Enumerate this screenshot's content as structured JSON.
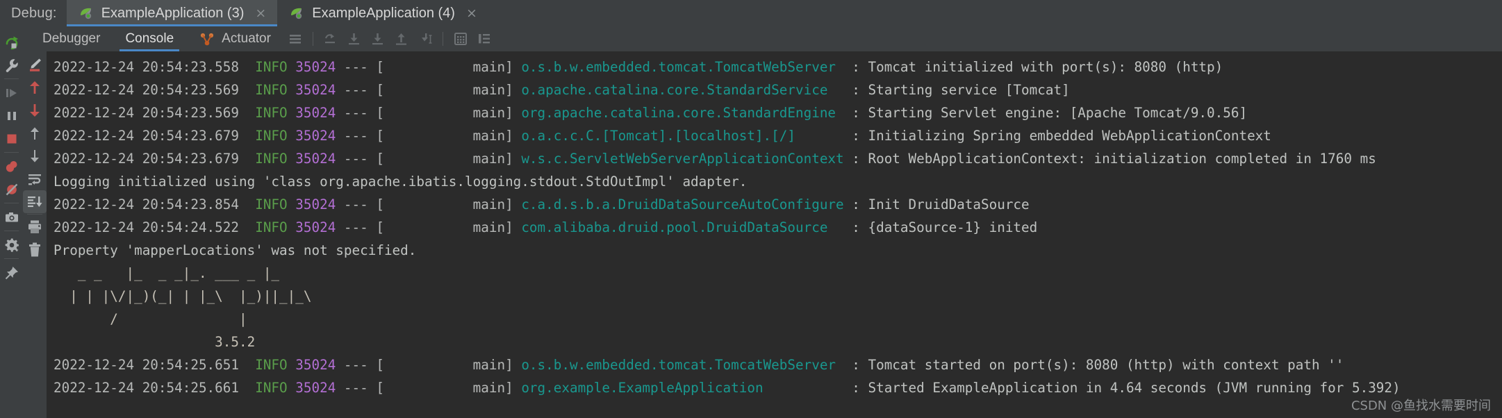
{
  "window": {
    "debug_label": "Debug:",
    "tabs": [
      {
        "title": "ExampleApplication (3)",
        "close": "×",
        "active": true,
        "icon": "spring-boot-icon"
      },
      {
        "title": "ExampleApplication (4)",
        "close": "×",
        "active": false,
        "icon": "spring-boot-icon"
      }
    ]
  },
  "left_rail": {
    "items": [
      {
        "name": "rerun-icon",
        "label": "Rerun"
      },
      {
        "name": "wrench-icon",
        "label": "Edit Configuration"
      },
      {
        "name": "resume-program-icon",
        "label": "Resume Program"
      },
      {
        "name": "pause-program-icon",
        "label": "Pause Program"
      },
      {
        "name": "stop-icon",
        "label": "Stop"
      },
      {
        "name": "view-breakpoints-icon",
        "label": "View Breakpoints"
      },
      {
        "name": "mute-breakpoints-icon",
        "label": "Mute Breakpoints"
      },
      {
        "name": "camera-icon",
        "label": "Get Thread Dump"
      },
      {
        "name": "settings-gear-icon",
        "label": "Settings"
      },
      {
        "name": "pin-icon",
        "label": "Pin Tab"
      }
    ]
  },
  "console_toolbar": {
    "tabs": [
      {
        "label": "Debugger",
        "selected": false,
        "icon": null
      },
      {
        "label": "Console",
        "selected": true,
        "icon": null
      },
      {
        "label": "Actuator",
        "selected": false,
        "icon": "actuator-icon"
      }
    ],
    "buttons": [
      {
        "name": "console-view-icon",
        "label": "Console View"
      },
      {
        "name": "step-over-icon",
        "label": "Step Over"
      },
      {
        "name": "step-into-icon",
        "label": "Step Into"
      },
      {
        "name": "force-step-into-icon",
        "label": "Force Step Into"
      },
      {
        "name": "step-out-icon",
        "label": "Step Out"
      },
      {
        "name": "run-to-cursor-icon",
        "label": "Run to Cursor"
      },
      {
        "name": "evaluate-expression-icon",
        "label": "Evaluate Expression"
      },
      {
        "name": "layout-icon",
        "label": "Layout Settings"
      }
    ]
  },
  "console_gutter": {
    "items": [
      {
        "name": "highlight-pencil-icon",
        "label": "Highlight"
      },
      {
        "name": "previous-occurrence-red-icon",
        "label": "Previous Error"
      },
      {
        "name": "next-occurrence-red-icon",
        "label": "Next Error"
      },
      {
        "name": "previous-occurrence-icon",
        "label": "Up"
      },
      {
        "name": "next-occurrence-icon",
        "label": "Down"
      },
      {
        "name": "soft-wrap-icon",
        "label": "Soft-Wrap"
      },
      {
        "name": "scroll-to-end-icon",
        "label": "Scroll to the end",
        "active": true
      },
      {
        "name": "print-icon",
        "label": "Print"
      },
      {
        "name": "trash-icon",
        "label": "Clear All"
      }
    ]
  },
  "console_log": {
    "lines": [
      {
        "type": "log",
        "ts": "2022-12-24 20:54:23.558",
        "level": "INFO",
        "pid": "35024",
        "sep": "---",
        "thread": "main",
        "logger": "o.s.b.w.embedded.tomcat.TomcatWebServer",
        "message": "Tomcat initialized with port(s): 8080 (http)"
      },
      {
        "type": "log",
        "ts": "2022-12-24 20:54:23.569",
        "level": "INFO",
        "pid": "35024",
        "sep": "---",
        "thread": "main",
        "logger": "o.apache.catalina.core.StandardService",
        "message": "Starting service [Tomcat]"
      },
      {
        "type": "log",
        "ts": "2022-12-24 20:54:23.569",
        "level": "INFO",
        "pid": "35024",
        "sep": "---",
        "thread": "main",
        "logger": "org.apache.catalina.core.StandardEngine",
        "message": "Starting Servlet engine: [Apache Tomcat/9.0.56]"
      },
      {
        "type": "log",
        "ts": "2022-12-24 20:54:23.679",
        "level": "INFO",
        "pid": "35024",
        "sep": "---",
        "thread": "main",
        "logger": "o.a.c.c.C.[Tomcat].[localhost].[/]",
        "message": "Initializing Spring embedded WebApplicationContext"
      },
      {
        "type": "log",
        "ts": "2022-12-24 20:54:23.679",
        "level": "INFO",
        "pid": "35024",
        "sep": "---",
        "thread": "main",
        "logger": "w.s.c.ServletWebServerApplicationContext",
        "message": "Root WebApplicationContext: initialization completed in 1760 ms"
      },
      {
        "type": "plain",
        "text": "Logging initialized using 'class org.apache.ibatis.logging.stdout.StdOutImpl' adapter."
      },
      {
        "type": "log",
        "ts": "2022-12-24 20:54:23.854",
        "level": "INFO",
        "pid": "35024",
        "sep": "---",
        "thread": "main",
        "logger": "c.a.d.s.b.a.DruidDataSourceAutoConfigure",
        "message": "Init DruidDataSource"
      },
      {
        "type": "log",
        "ts": "2022-12-24 20:54:24.522",
        "level": "INFO",
        "pid": "35024",
        "sep": "---",
        "thread": "main",
        "logger": "com.alibaba.druid.pool.DruidDataSource",
        "message": "{dataSource-1} inited"
      },
      {
        "type": "plain",
        "text": "Property 'mapperLocations' was not specified."
      },
      {
        "type": "banner",
        "text": "   _ _   |_  _ _|_. ___ _ |_"
      },
      {
        "type": "banner",
        "text": "  | | |\\/|_)(_| | |_\\  |_)||_|_\\"
      },
      {
        "type": "banner",
        "text": "       /               |"
      },
      {
        "type": "banner",
        "text": "                    3.5.2"
      },
      {
        "type": "log",
        "ts": "2022-12-24 20:54:25.651",
        "level": "INFO",
        "pid": "35024",
        "sep": "---",
        "thread": "main",
        "logger": "o.s.b.w.embedded.tomcat.TomcatWebServer",
        "message": "Tomcat started on port(s): 8080 (http) with context path ''"
      },
      {
        "type": "log",
        "ts": "2022-12-24 20:54:25.661",
        "level": "INFO",
        "pid": "35024",
        "sep": "---",
        "thread": "main",
        "logger": "org.example.ExampleApplication",
        "message": "Started ExampleApplication in 4.64 seconds (JVM running for 5.392)"
      }
    ]
  },
  "watermark": {
    "text": "CSDN @鱼找水需要时间"
  },
  "colors": {
    "background": "#3c3f41",
    "console_background": "#2b2b2b",
    "accent": "#4a88c7",
    "level_info": "#5a9e4b",
    "pid": "#b36fd4",
    "logger": "#19988f",
    "text": "#c0c3c1",
    "stop_red": "#c75450",
    "spring_green": "#6db33f"
  }
}
